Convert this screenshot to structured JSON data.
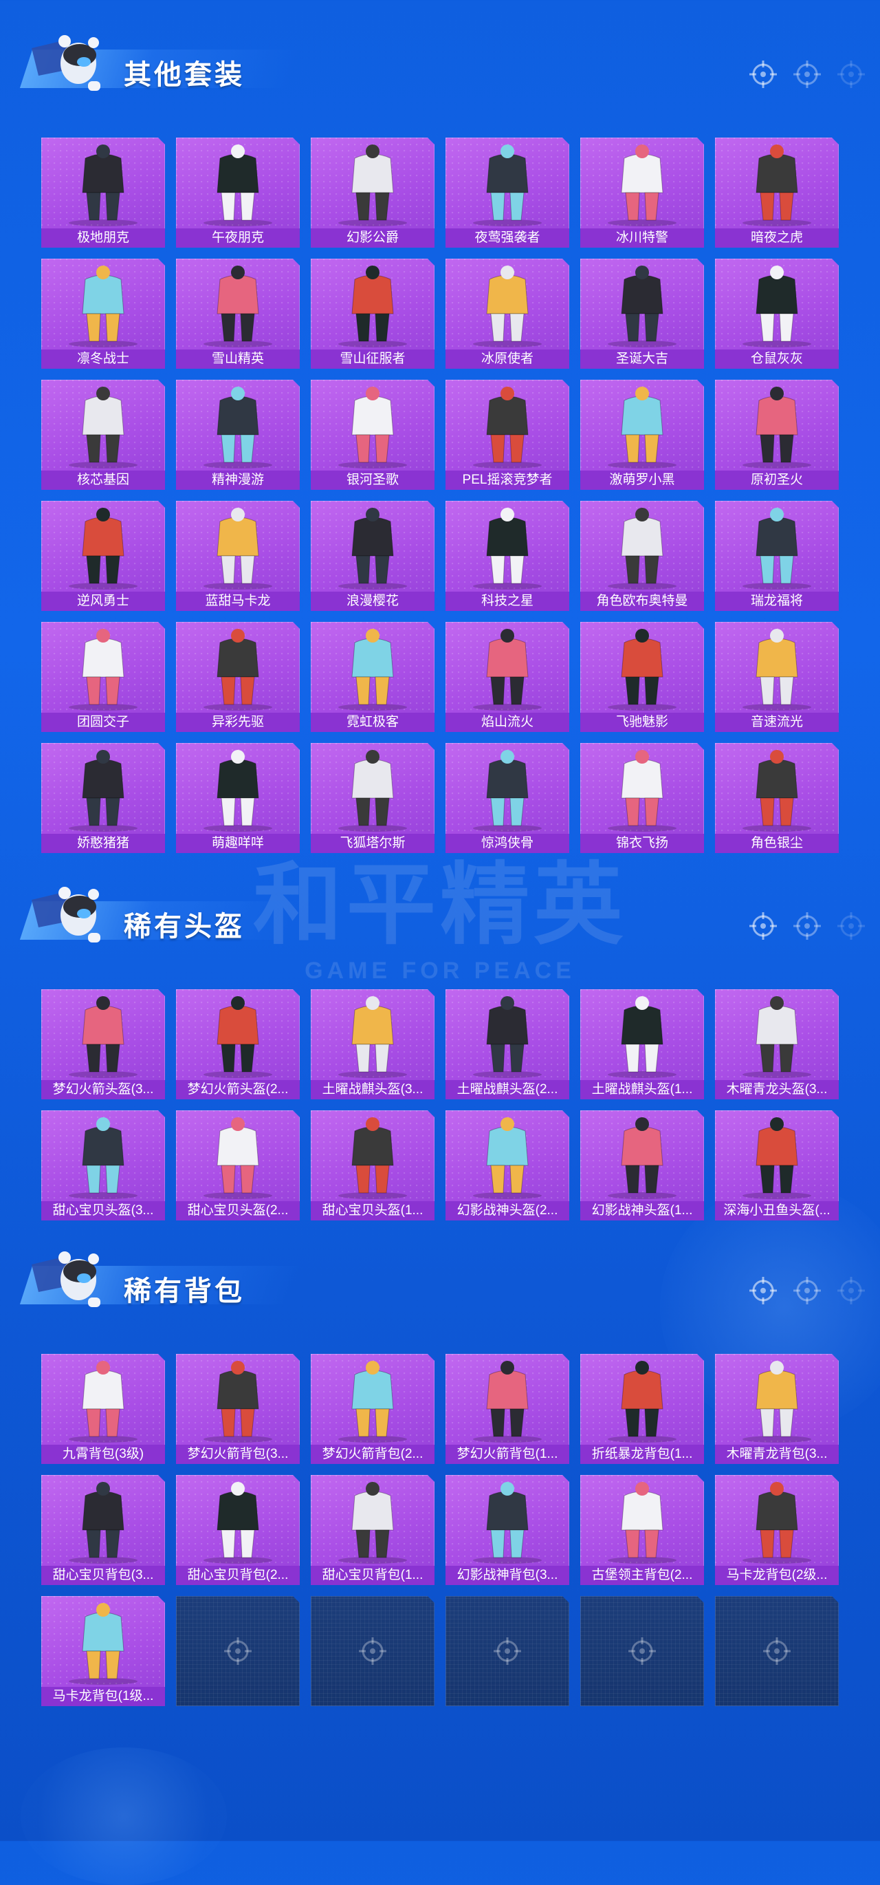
{
  "colors": {
    "background": "#1266ea",
    "card": "#b05ae8",
    "label_bar": "#8a33d2",
    "empty_card": "#1c3d7a"
  },
  "watermark": {
    "title": "和平精英",
    "subtitle": "GAME FOR PEACE"
  },
  "sections": [
    {
      "title": "其他套装",
      "icon": "soldier-mascot-icon",
      "items": [
        "极地朋克",
        "午夜朋克",
        "幻影公爵",
        "夜莺强袭者",
        "冰川特警",
        "暗夜之虎",
        "凛冬战士",
        "雪山精英",
        "雪山征服者",
        "冰原使者",
        "圣诞大吉",
        "仓鼠灰灰",
        "核芯基因",
        "精神漫游",
        "银河圣歌",
        "PEL摇滚竞梦者",
        "激萌罗小黑",
        "原初圣火",
        "逆风勇士",
        "蓝甜马卡龙",
        "浪漫樱花",
        "科技之星",
        "角色欧布奥特曼",
        "瑞龙福将",
        "团圆交子",
        "异彩先驱",
        "霓虹极客",
        "焰山流火",
        "飞驰魅影",
        "音速流光",
        "娇憨猪猪",
        "萌趣咩咩",
        "飞狐塔尔斯",
        "惊鸿侠骨",
        "锦衣飞扬",
        "角色银尘"
      ],
      "empty_slots": 0
    },
    {
      "title": "稀有头盔",
      "icon": "soldier-mascot-icon",
      "items": [
        "梦幻火箭头盔(3...",
        "梦幻火箭头盔(2...",
        "土曜战麒头盔(3...",
        "土曜战麒头盔(2...",
        "土曜战麒头盔(1...",
        "木曜青龙头盔(3...",
        "甜心宝贝头盔(3...",
        "甜心宝贝头盔(2...",
        "甜心宝贝头盔(1...",
        "幻影战神头盔(2...",
        "幻影战神头盔(1...",
        "深海小丑鱼头盔(..."
      ],
      "empty_slots": 0
    },
    {
      "title": "稀有背包",
      "icon": "soldier-mascot-icon",
      "items": [
        "九霄背包(3级)",
        "梦幻火箭背包(3...",
        "梦幻火箭背包(2...",
        "梦幻火箭背包(1...",
        "折纸暴龙背包(1...",
        "木曜青龙背包(3...",
        "甜心宝贝背包(3...",
        "甜心宝贝背包(2...",
        "甜心宝贝背包(1...",
        "幻影战神背包(3...",
        "古堡领主背包(2...",
        "马卡龙背包(2级...",
        "马卡龙背包(1级..."
      ],
      "empty_slots": 5
    }
  ]
}
